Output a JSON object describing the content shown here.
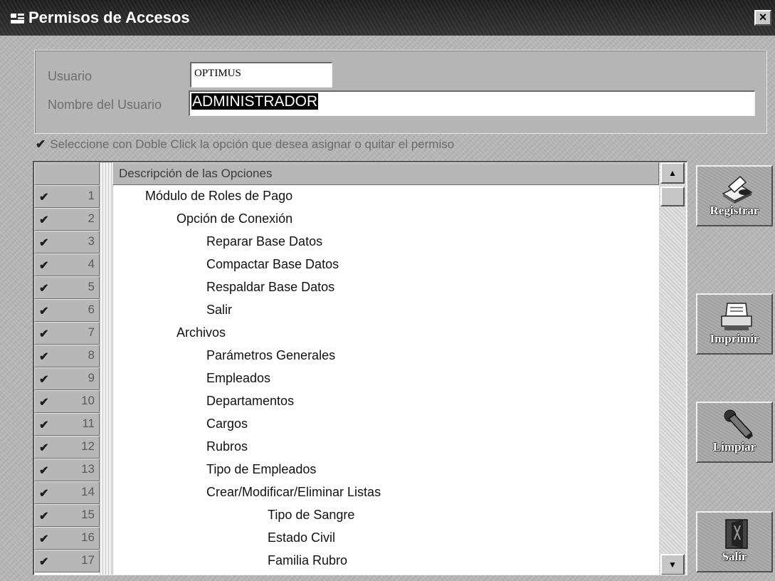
{
  "window": {
    "title": "Permisos de Accesos",
    "close_glyph": "×"
  },
  "user": {
    "usuario_label": "Usuario",
    "usuario_value": "OPTIMUS",
    "nombre_label": "Nombre del Usuario",
    "nombre_value": "ADMINISTRADOR"
  },
  "instruction": "Seleccione con Doble Click la opción que desea asignar o quitar el permiso",
  "grid": {
    "column_header": "Descripción de las Opciones",
    "rows": [
      {
        "num": "1",
        "label": "Módulo de Roles de Pago",
        "level": 0,
        "checked": true
      },
      {
        "num": "2",
        "label": "Opción de Conexión",
        "level": 1,
        "checked": true
      },
      {
        "num": "3",
        "label": "Reparar Base Datos",
        "level": 2,
        "checked": true
      },
      {
        "num": "4",
        "label": "Compactar Base Datos",
        "level": 2,
        "checked": true
      },
      {
        "num": "5",
        "label": "Respaldar Base Datos",
        "level": 2,
        "checked": true
      },
      {
        "num": "6",
        "label": "Salir",
        "level": 2,
        "checked": true
      },
      {
        "num": "7",
        "label": "Archivos",
        "level": 1,
        "checked": true
      },
      {
        "num": "8",
        "label": "Parámetros Generales",
        "level": 2,
        "checked": true
      },
      {
        "num": "9",
        "label": "Empleados",
        "level": 2,
        "checked": true
      },
      {
        "num": "10",
        "label": "Departamentos",
        "level": 2,
        "checked": true
      },
      {
        "num": "11",
        "label": "Cargos",
        "level": 2,
        "checked": true
      },
      {
        "num": "12",
        "label": "Rubros",
        "level": 2,
        "checked": true
      },
      {
        "num": "13",
        "label": "Tipo de Empleados",
        "level": 2,
        "checked": true
      },
      {
        "num": "14",
        "label": "Crear/Modificar/Eliminar Listas",
        "level": 2,
        "checked": true
      },
      {
        "num": "15",
        "label": "Tipo de Sangre",
        "level": 3,
        "checked": true
      },
      {
        "num": "16",
        "label": "Estado Civil",
        "level": 3,
        "checked": true
      },
      {
        "num": "17",
        "label": "Familia Rubro",
        "level": 3,
        "checked": true
      }
    ]
  },
  "buttons": {
    "registrar": "Registrar",
    "imprimir": "Imprimir",
    "limpiar": "Limpiar",
    "salir": "Salir"
  }
}
